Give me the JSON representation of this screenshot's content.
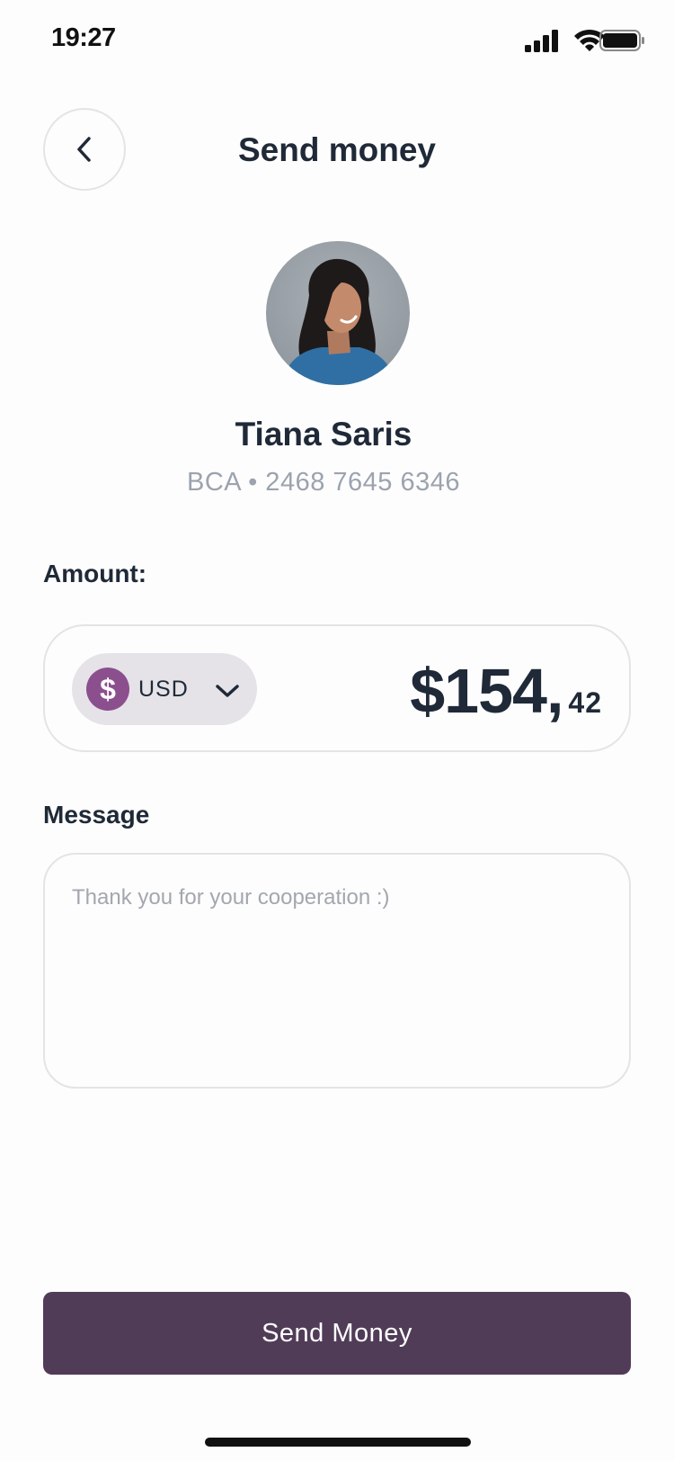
{
  "status_bar": {
    "time": "19:27"
  },
  "header": {
    "title": "Send money"
  },
  "recipient": {
    "name": "Tiana Saris",
    "account": "BCA • 2468 7645 6346"
  },
  "amount": {
    "label": "Amount:",
    "currency_symbol": "$",
    "currency_code": "USD",
    "value_main": "$154,",
    "value_cents": "42"
  },
  "message": {
    "label": "Message",
    "placeholder": "Thank you for your cooperation :)"
  },
  "send_button": {
    "label": "Send Money"
  },
  "colors": {
    "primary_button": "#513c58",
    "currency_accent": "#8c4f8e",
    "currency_pill_bg": "#e5e3e8"
  }
}
